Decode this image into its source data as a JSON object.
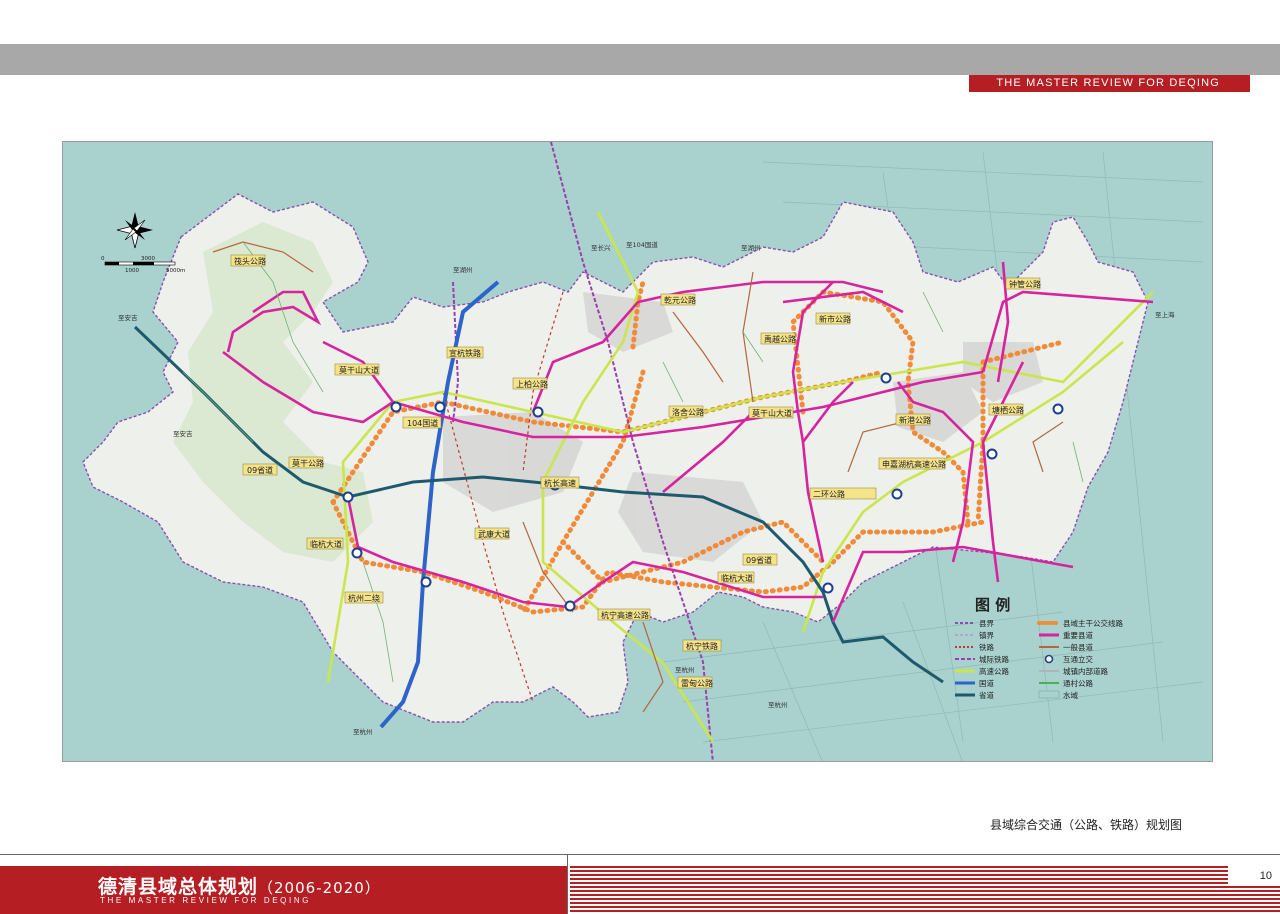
{
  "header": {
    "banner_text": "THE MASTER REVIEW FOR DEQING"
  },
  "map": {
    "caption": "县域综合交通（公路、铁路）规划图",
    "scale_labels": [
      "0",
      "1000",
      "3000",
      "5000m"
    ],
    "road_labels": {
      "r1": "莫干山大道",
      "r2": "104国道",
      "r3": "宣杭铁路",
      "r4": "09省道",
      "r5": "临杭大道",
      "r6": "杭州二绕",
      "r7": "杭宁高速公路",
      "r8": "杭宁铁路",
      "r9": "申嘉湖杭高速公路",
      "r10": "莫干山大道",
      "r11": "二环公路",
      "r12": "09省道",
      "r13": "临杭大道",
      "r14": "杭长高速",
      "r15": "塘栖公路",
      "r16": "新市公路",
      "r17": "钟管公路",
      "r18": "上柏公路",
      "r19": "武康大道",
      "r20": "洛舍公路",
      "r21": "乾元公路",
      "r22": "雷甸公路",
      "r23": "新港公路",
      "r24": "禹越公路",
      "r25": "莫干公路",
      "r26": "筏头公路"
    },
    "place_labels": {
      "p1": "至湖州",
      "p2": "至长兴",
      "p3": "至104国道",
      "p4": "至湖州",
      "p5": "至上海",
      "p6": "至杭州",
      "p7": "至杭州",
      "p8": "至杭州",
      "p9": "至安吉",
      "p10": "至安吉"
    },
    "legend": {
      "title": "图    例",
      "items": [
        {
          "label": "县界",
          "color": "#8a4fae"
        },
        {
          "label": "镇界",
          "color": "#b7a3cf"
        },
        {
          "label": "铁路",
          "color": "#c0392b"
        },
        {
          "label": "城际铁路",
          "color": "#9b3fb0"
        },
        {
          "label": "高速公路",
          "color": "#c9e64a"
        },
        {
          "label": "国道",
          "color": "#2e63c9"
        },
        {
          "label": "省道",
          "color": "#1e5a6e"
        },
        {
          "label": "县域主干公交线路",
          "color": "#f08b3a"
        },
        {
          "label": "重要县道",
          "color": "#d6239e"
        },
        {
          "label": "一般县道",
          "color": "#b5673a"
        },
        {
          "label": "互通立交",
          "color": "#1c3f8f"
        },
        {
          "label": "城镇内部道路",
          "color": "#aeb4bd"
        },
        {
          "label": "通村公路",
          "color": "#4caf50"
        },
        {
          "label": "水域",
          "color": "#a9d2cf"
        }
      ]
    }
  },
  "footer": {
    "title": "德清县域总体规划",
    "years": "（2006-2020）",
    "subtitle": "THE MASTER REVIEW FOR DEQING",
    "page_number": "10"
  }
}
